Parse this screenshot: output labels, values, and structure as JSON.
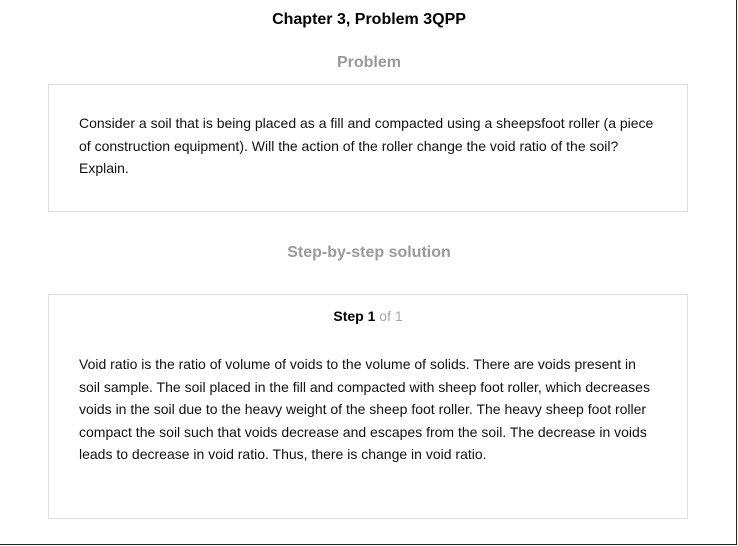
{
  "header": {
    "title": "Chapter 3, Problem 3QPP"
  },
  "problem": {
    "heading": "Problem",
    "text": "Consider a soil that is being placed as a fill and compacted using a sheepsfoot roller (a piece of construction equipment). Will the action of the roller change the void ratio of the soil? Explain."
  },
  "solution": {
    "heading": "Step-by-step solution",
    "step_word": "Step",
    "step_number": "1",
    "step_of": "of 1",
    "text": "Void ratio is the ratio of volume of voids to the volume of solids. There are voids present in soil sample. The soil placed in the fill and compacted with sheep foot roller, which decreases voids in the soil due to the heavy weight of the sheep foot roller. The heavy sheep foot roller compact the soil such that voids decrease and escapes from the soil. The decrease in voids leads to decrease in void ratio. Thus, there is change in void ratio."
  }
}
